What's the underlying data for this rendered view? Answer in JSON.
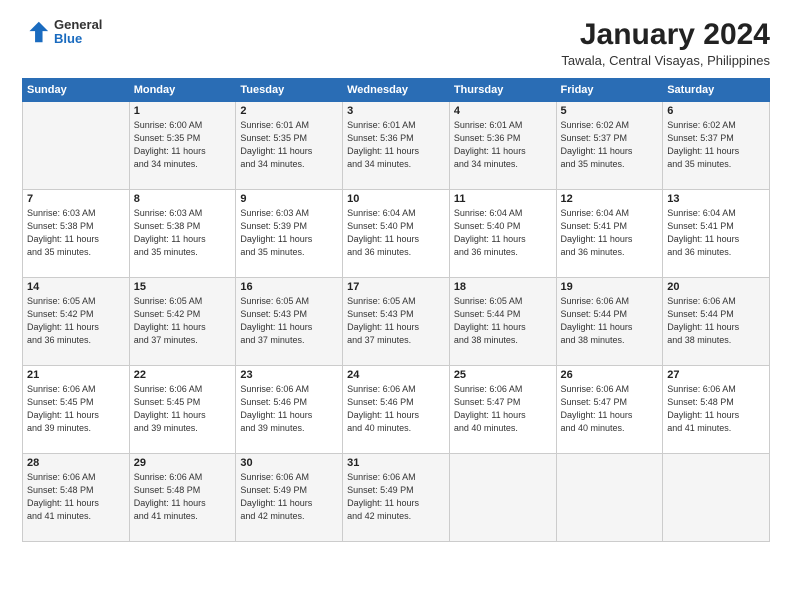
{
  "header": {
    "logo": {
      "line1": "General",
      "line2": "Blue"
    },
    "title": "January 2024",
    "location": "Tawala, Central Visayas, Philippines"
  },
  "days_of_week": [
    "Sunday",
    "Monday",
    "Tuesday",
    "Wednesday",
    "Thursday",
    "Friday",
    "Saturday"
  ],
  "weeks": [
    [
      {
        "day": "",
        "info": ""
      },
      {
        "day": "1",
        "info": "Sunrise: 6:00 AM\nSunset: 5:35 PM\nDaylight: 11 hours\nand 34 minutes."
      },
      {
        "day": "2",
        "info": "Sunrise: 6:01 AM\nSunset: 5:35 PM\nDaylight: 11 hours\nand 34 minutes."
      },
      {
        "day": "3",
        "info": "Sunrise: 6:01 AM\nSunset: 5:36 PM\nDaylight: 11 hours\nand 34 minutes."
      },
      {
        "day": "4",
        "info": "Sunrise: 6:01 AM\nSunset: 5:36 PM\nDaylight: 11 hours\nand 34 minutes."
      },
      {
        "day": "5",
        "info": "Sunrise: 6:02 AM\nSunset: 5:37 PM\nDaylight: 11 hours\nand 35 minutes."
      },
      {
        "day": "6",
        "info": "Sunrise: 6:02 AM\nSunset: 5:37 PM\nDaylight: 11 hours\nand 35 minutes."
      }
    ],
    [
      {
        "day": "7",
        "info": "Sunrise: 6:03 AM\nSunset: 5:38 PM\nDaylight: 11 hours\nand 35 minutes."
      },
      {
        "day": "8",
        "info": "Sunrise: 6:03 AM\nSunset: 5:38 PM\nDaylight: 11 hours\nand 35 minutes."
      },
      {
        "day": "9",
        "info": "Sunrise: 6:03 AM\nSunset: 5:39 PM\nDaylight: 11 hours\nand 35 minutes."
      },
      {
        "day": "10",
        "info": "Sunrise: 6:04 AM\nSunset: 5:40 PM\nDaylight: 11 hours\nand 36 minutes."
      },
      {
        "day": "11",
        "info": "Sunrise: 6:04 AM\nSunset: 5:40 PM\nDaylight: 11 hours\nand 36 minutes."
      },
      {
        "day": "12",
        "info": "Sunrise: 6:04 AM\nSunset: 5:41 PM\nDaylight: 11 hours\nand 36 minutes."
      },
      {
        "day": "13",
        "info": "Sunrise: 6:04 AM\nSunset: 5:41 PM\nDaylight: 11 hours\nand 36 minutes."
      }
    ],
    [
      {
        "day": "14",
        "info": "Sunrise: 6:05 AM\nSunset: 5:42 PM\nDaylight: 11 hours\nand 36 minutes."
      },
      {
        "day": "15",
        "info": "Sunrise: 6:05 AM\nSunset: 5:42 PM\nDaylight: 11 hours\nand 37 minutes."
      },
      {
        "day": "16",
        "info": "Sunrise: 6:05 AM\nSunset: 5:43 PM\nDaylight: 11 hours\nand 37 minutes."
      },
      {
        "day": "17",
        "info": "Sunrise: 6:05 AM\nSunset: 5:43 PM\nDaylight: 11 hours\nand 37 minutes."
      },
      {
        "day": "18",
        "info": "Sunrise: 6:05 AM\nSunset: 5:44 PM\nDaylight: 11 hours\nand 38 minutes."
      },
      {
        "day": "19",
        "info": "Sunrise: 6:06 AM\nSunset: 5:44 PM\nDaylight: 11 hours\nand 38 minutes."
      },
      {
        "day": "20",
        "info": "Sunrise: 6:06 AM\nSunset: 5:44 PM\nDaylight: 11 hours\nand 38 minutes."
      }
    ],
    [
      {
        "day": "21",
        "info": "Sunrise: 6:06 AM\nSunset: 5:45 PM\nDaylight: 11 hours\nand 39 minutes."
      },
      {
        "day": "22",
        "info": "Sunrise: 6:06 AM\nSunset: 5:45 PM\nDaylight: 11 hours\nand 39 minutes."
      },
      {
        "day": "23",
        "info": "Sunrise: 6:06 AM\nSunset: 5:46 PM\nDaylight: 11 hours\nand 39 minutes."
      },
      {
        "day": "24",
        "info": "Sunrise: 6:06 AM\nSunset: 5:46 PM\nDaylight: 11 hours\nand 40 minutes."
      },
      {
        "day": "25",
        "info": "Sunrise: 6:06 AM\nSunset: 5:47 PM\nDaylight: 11 hours\nand 40 minutes."
      },
      {
        "day": "26",
        "info": "Sunrise: 6:06 AM\nSunset: 5:47 PM\nDaylight: 11 hours\nand 40 minutes."
      },
      {
        "day": "27",
        "info": "Sunrise: 6:06 AM\nSunset: 5:48 PM\nDaylight: 11 hours\nand 41 minutes."
      }
    ],
    [
      {
        "day": "28",
        "info": "Sunrise: 6:06 AM\nSunset: 5:48 PM\nDaylight: 11 hours\nand 41 minutes."
      },
      {
        "day": "29",
        "info": "Sunrise: 6:06 AM\nSunset: 5:48 PM\nDaylight: 11 hours\nand 41 minutes."
      },
      {
        "day": "30",
        "info": "Sunrise: 6:06 AM\nSunset: 5:49 PM\nDaylight: 11 hours\nand 42 minutes."
      },
      {
        "day": "31",
        "info": "Sunrise: 6:06 AM\nSunset: 5:49 PM\nDaylight: 11 hours\nand 42 minutes."
      },
      {
        "day": "",
        "info": ""
      },
      {
        "day": "",
        "info": ""
      },
      {
        "day": "",
        "info": ""
      }
    ]
  ]
}
